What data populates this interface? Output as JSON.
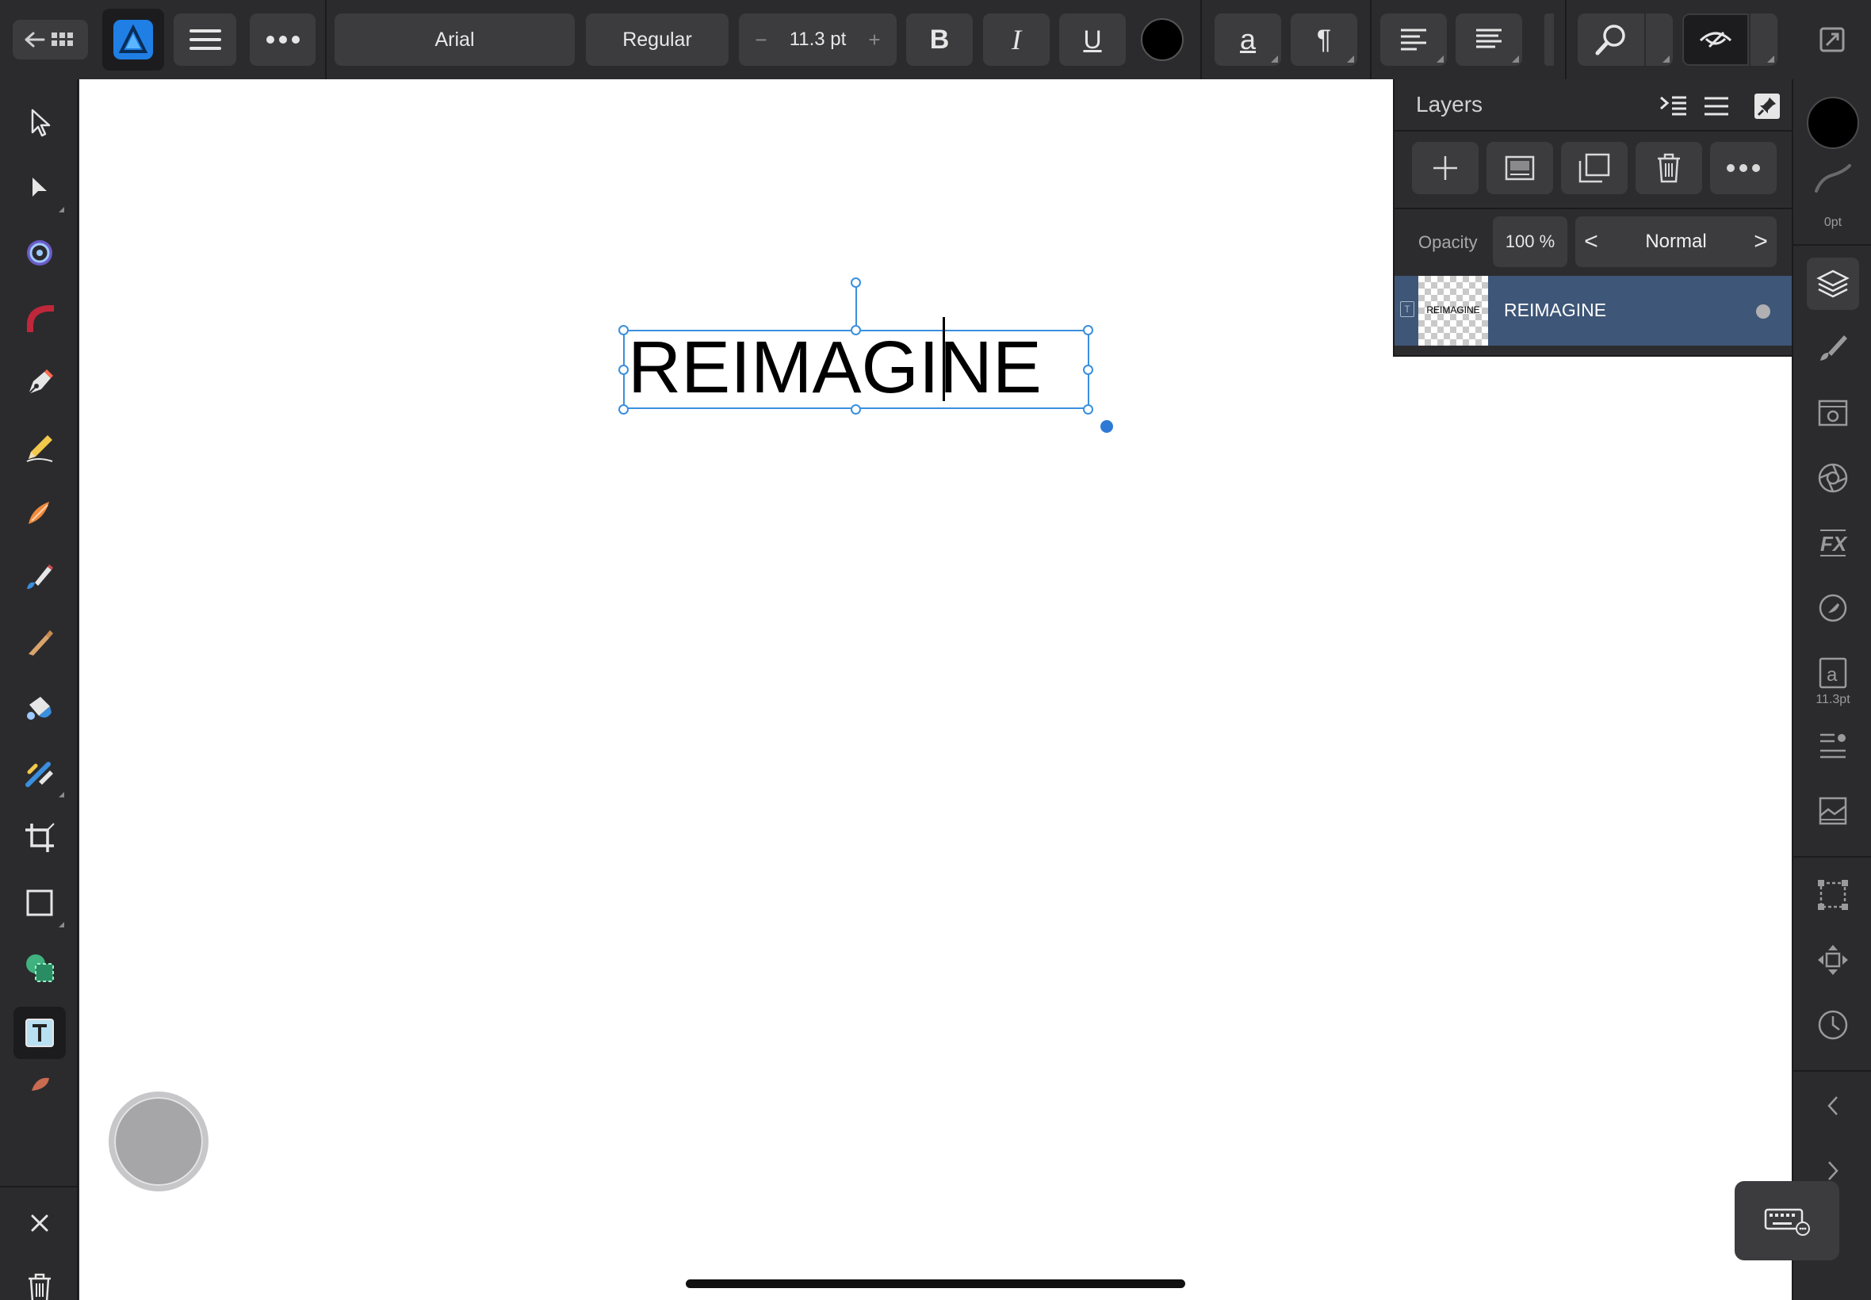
{
  "toolbar": {
    "font_family": "Arial",
    "font_style": "Regular",
    "font_size": "11.3 pt",
    "decrease_symbol": "−",
    "increase_symbol": "+",
    "bold_label": "B",
    "italic_label": "I",
    "underline_label": "U",
    "char_label": "a",
    "paragraph_label": "¶",
    "text_color": "#000000"
  },
  "canvas": {
    "text": "REIMAGINE",
    "background": "#ffffff"
  },
  "layers_panel": {
    "title": "Layers",
    "opacity_label": "Opacity",
    "opacity_value": "100 %",
    "blend_mode": "Normal",
    "blend_prev": "<",
    "blend_next": ">",
    "layers": [
      {
        "name": "REIMAGINE",
        "type_icon": "T",
        "thumbnail_text": "REIMAGINE",
        "selected": true
      }
    ]
  },
  "studio": {
    "stroke_width": "0pt",
    "character_size": "11.3pt",
    "character_glyph": "a"
  },
  "colors": {
    "accent": "#3a8fde",
    "selected_layer": "#3e5677",
    "ui_background": "#2b2b2d",
    "button": "#3c3c3e",
    "app_icon": "#1f7fe5"
  },
  "icons": {
    "top": [
      "back-to-documents-icon",
      "affinity-designer-logo",
      "menu-icon",
      "more-icon",
      "zoom-icon",
      "view-mode-icon",
      "fullscreen-icon"
    ],
    "left_tools": [
      "move-tool-icon",
      "node-tool-icon",
      "corner-tool-icon",
      "point-transform-tool-icon",
      "pen-tool-icon",
      "pencil-tool-icon",
      "vector-brush-tool-icon",
      "fill-tool-icon",
      "transparency-tool-icon",
      "place-image-tool-icon",
      "vector-crop-tool-icon",
      "rectangle-tool-icon",
      "shape-builder-tool-icon",
      "artistic-text-tool-icon",
      "pixel-persona-icon",
      "close-icon",
      "delete-icon"
    ],
    "studio": [
      "color-swatch",
      "stroke-icon",
      "layers-icon",
      "brushes-icon",
      "appearance-icon",
      "adjustments-icon",
      "fx-icon",
      "color-icon",
      "character-icon",
      "paragraph-icon",
      "stock-icon",
      "transform-icon",
      "snapping-icon",
      "history-icon",
      "collapse-left-icon",
      "collapse-right-icon"
    ]
  }
}
